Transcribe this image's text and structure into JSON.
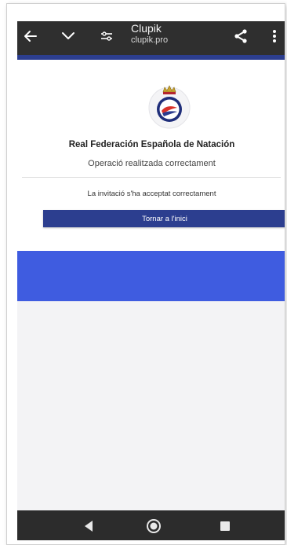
{
  "browser": {
    "title": "Clupik",
    "url": "clupik.pro"
  },
  "page": {
    "org_name": "Real Federación Española de Natación",
    "operation_message": "Operació realitzada correctament",
    "invitation_message": "La invitació s'ha acceptat correctament",
    "home_button_label": "Tornar a l'inici"
  },
  "colors": {
    "topbar": "#2f2f2f",
    "accent": "#2c3e8f",
    "button": "#2c3e8f",
    "band": "#3f5ce0",
    "navbar": "#2c2c2c"
  },
  "icons": {
    "topbar": [
      "back-arrow-icon",
      "chevron-down-icon",
      "tune-icon",
      "share-icon",
      "more-vert-icon"
    ],
    "navbar": [
      "nav-back-icon",
      "nav-home-icon",
      "nav-recent-icon"
    ],
    "logo": "rfen-logo"
  }
}
